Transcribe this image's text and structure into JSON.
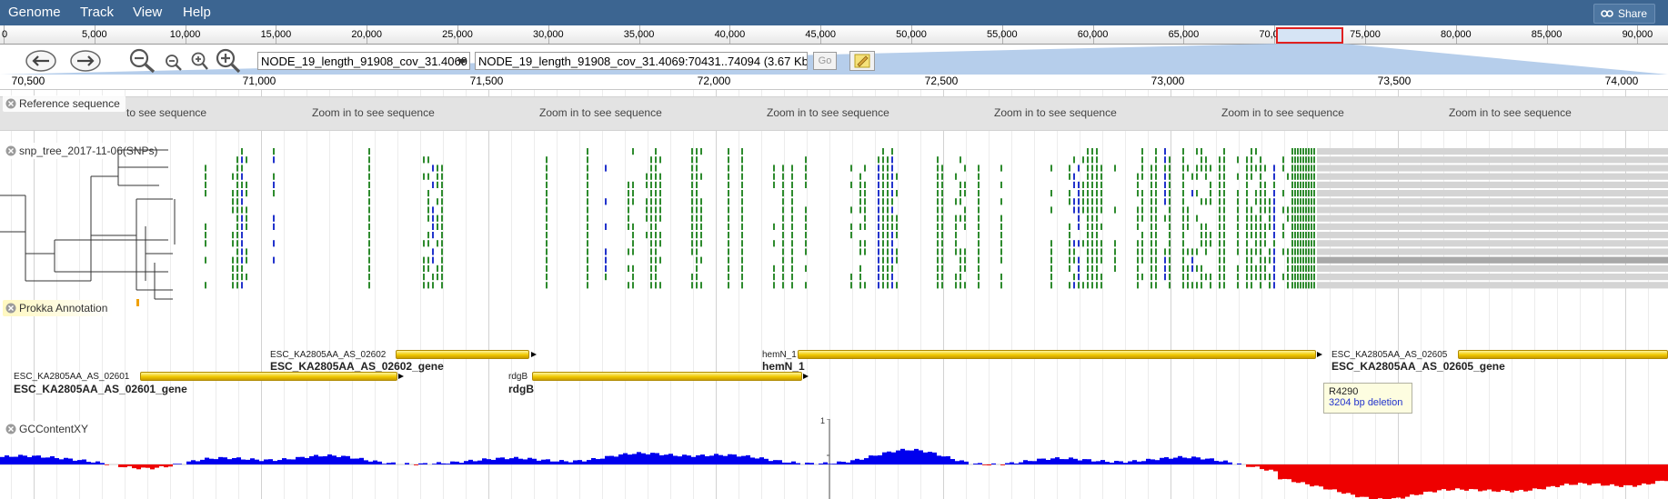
{
  "menu": {
    "genome": "Genome",
    "track": "Track",
    "view": "View",
    "help": "Help"
  },
  "share_label": "Share",
  "overview_ticks": [
    "0",
    "5,000",
    "10,000",
    "15,000",
    "20,000",
    "25,000",
    "30,000",
    "35,000",
    "40,000",
    "45,000",
    "50,000",
    "55,000",
    "60,000",
    "65,000",
    "70,000",
    "75,000",
    "80,000",
    "85,000",
    "90,000"
  ],
  "refseq_select": "NODE_19_length_91908_cov_31.4069",
  "location": "NODE_19_length_91908_cov_31.4069:70431..74094 (3.67 Kb)",
  "go_label": "Go",
  "ruler_labels": [
    "70,500",
    "71,000",
    "71,500",
    "72,000",
    "72,500",
    "73,000",
    "73,500",
    "74,000"
  ],
  "tracks": {
    "reference": {
      "label": "Reference sequence",
      "zoom_messages": [
        "to see sequence",
        "Zoom in to see sequence",
        "Zoom in to see sequence",
        "Zoom in to see sequence",
        "Zoom in to see sequence",
        "Zoom in to see sequence",
        "Zoom in to see sequence"
      ]
    },
    "snp": {
      "label": "snp_tree_2017-11-06(SNPs)"
    },
    "prokka": {
      "label": "Prokka Annotation",
      "features": [
        {
          "id": "ESC_KA2805AA_AS_02602",
          "name": "ESC_KA2805AA_AS_02602_gene"
        },
        {
          "id": "hemN_1",
          "name": "hemN_1"
        },
        {
          "id": "ESC_KA2805AA_AS_02605",
          "name": "ESC_KA2805AA_AS_02605_gene"
        },
        {
          "id": "ESC_KA2805AA_AS_02601",
          "name": "ESC_KA2805AA_AS_02601_gene"
        },
        {
          "id": "rdgB",
          "name": "rdgB"
        }
      ]
    },
    "gc": {
      "label": "GCContentXY",
      "scale_top": "1"
    }
  },
  "tooltip": {
    "name": "R4290",
    "description": "3204 bp deletion"
  },
  "colors": {
    "menubar": "#3c6591",
    "snp_green": "#2e8b2e",
    "snp_blue": "#2233cc",
    "gc_above": "#0000ee",
    "gc_below": "#ee0000",
    "gene": "#f0c800"
  },
  "icons": [
    "pan-left-icon",
    "pan-right-icon",
    "zoom-out-big-icon",
    "zoom-out-small-icon",
    "zoom-in-small-icon",
    "zoom-in-big-icon",
    "dropdown-arrow-icon",
    "highlight-icon",
    "close-icon",
    "link-icon"
  ]
}
